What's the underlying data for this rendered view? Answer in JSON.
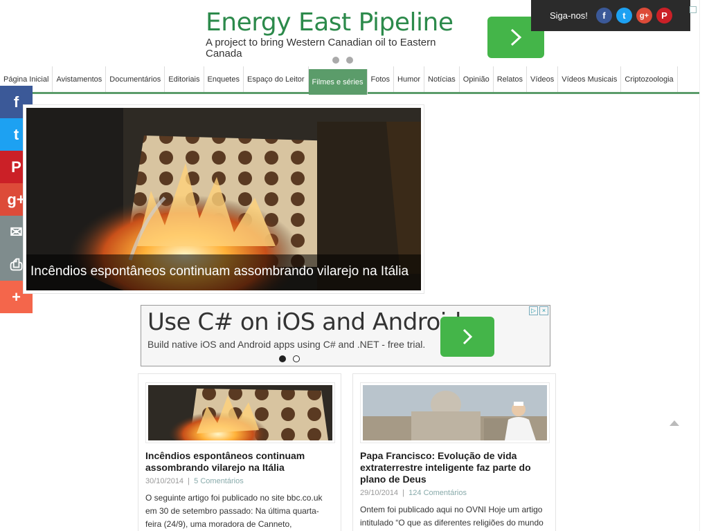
{
  "top_ad": {
    "title": "Energy East Pipeline",
    "description": "A project to bring Western Canadian oil to Eastern Canada",
    "go_icon": "chevron-right-icon"
  },
  "follow": {
    "label": "Siga-nos!",
    "networks": [
      "facebook",
      "twitter",
      "google-plus",
      "pinterest"
    ]
  },
  "nav": {
    "items": [
      "Página Inicial",
      "Avistamentos",
      "Documentários",
      "Editoriais",
      "Enquetes",
      "Espaço do Leitor",
      "Filmes e séries",
      "Fotos",
      "Humor",
      "Notícias",
      "Opinião",
      "Relatos",
      "Vídeos",
      "Vídeos Musicais",
      "Criptozoologia"
    ],
    "active_index": 6,
    "active_color": "#5b9c6a"
  },
  "share": {
    "buttons": [
      {
        "name": "facebook",
        "glyph": "f",
        "color": "#3b5998"
      },
      {
        "name": "twitter",
        "glyph": "t",
        "color": "#1da1f2"
      },
      {
        "name": "pinterest",
        "glyph": "P",
        "color": "#cb2027"
      },
      {
        "name": "google-plus",
        "glyph": "g+",
        "color": "#dd4b39"
      },
      {
        "name": "email",
        "glyph": "✉",
        "color": "#7f8c8d"
      },
      {
        "name": "print",
        "glyph": "⎙",
        "color": "#7f8c8d"
      },
      {
        "name": "more",
        "glyph": "+",
        "color": "#f4664b"
      }
    ]
  },
  "feature": {
    "caption": "Incêndios espontâneos continuam assombrando vilarejo na Itália"
  },
  "mid_ad": {
    "title": "Use C# on iOS and Android",
    "description": "Build native iOS and Android apps using C# and .NET - free trial."
  },
  "articles": [
    {
      "title": "Incêndios espontâneos continuam assombrando vilarejo na Itália",
      "date": "30/10/2014",
      "comments": "5 Comentários",
      "excerpt": "O seguinte artigo foi publicado no site bbc.co.uk em 30 de setembro passado: Na última quarta-feira (24/9), uma moradora de Canneto,"
    },
    {
      "title": "Papa Francisco: Evolução de vida extraterrestre inteligente faz parte do plano de Deus",
      "date": "29/10/2014",
      "comments": "124 Comentários",
      "excerpt": "Ontem foi publicado aqui no OVNI Hoje um artigo intitulado “O que as diferentes religiões do mundo"
    }
  ]
}
